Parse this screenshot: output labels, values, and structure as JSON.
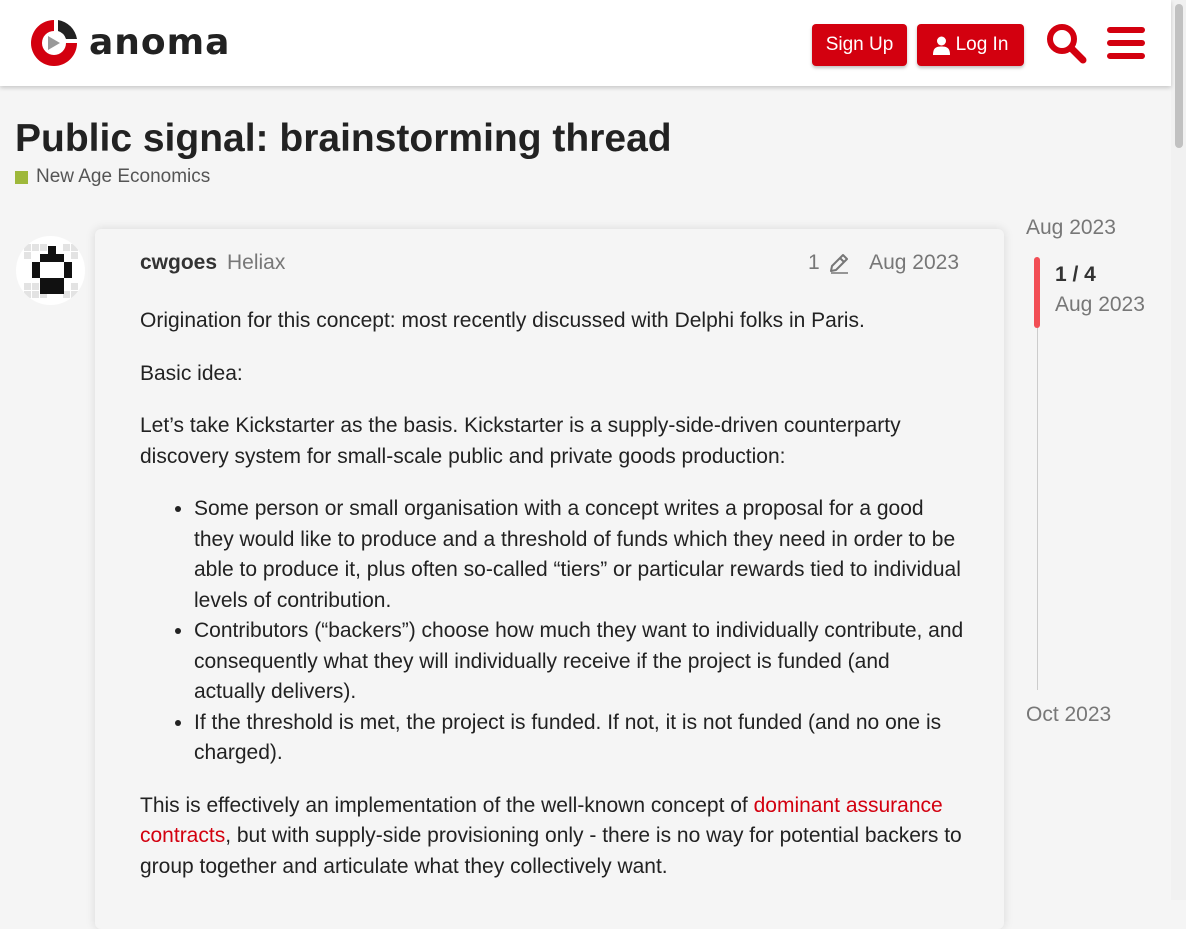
{
  "header": {
    "logo_text": "anoma",
    "signup_label": "Sign Up",
    "login_label": "Log In",
    "brand_color": "#d3000f",
    "search_icon": "search-icon",
    "menu_icon": "hamburger-menu-icon"
  },
  "topic": {
    "title": "Public signal: brainstorming thread",
    "category": "New Age Economics",
    "category_color": "#9eb83b"
  },
  "post": {
    "username": "cwgoes",
    "user_title": "Heliax",
    "edit_count": "1",
    "date": "Aug 2023",
    "paragraphs": {
      "p1": "Origination for this concept: most recently discussed with Delphi folks in Paris.",
      "p2": "Basic idea:",
      "p3": "Let’s take Kickstarter as the basis. Kickstarter is a supply-side-driven counterparty discovery system for small-scale public and private goods production:",
      "p4_before": "This is effectively an implementation of the well-known concept of ",
      "p4_link": "dominant assurance contracts",
      "p4_after": ", but with supply-side provisioning only - there is no way for potential backers to group together and articulate what they collectively want."
    },
    "list_items": [
      "Some person or small organisation with a concept writes a proposal for a good they would like to produce and a threshold of funds which they need in order to be able to produce it, plus often so-called “tiers” or particular rewards tied to individual levels of contribution.",
      "Contributors (“backers”) choose how much they want to individually contribute, and consequently what they will individually receive if the project is funded (and actually delivers).",
      "If the threshold is met, the project is funded. If not, it is not funded (and no one is charged)."
    ]
  },
  "timeline": {
    "start_date": "Aug 2023",
    "position": "1 / 4",
    "current_date": "Aug 2023",
    "end_date": "Oct 2023",
    "handle_color": "#f24e55"
  }
}
